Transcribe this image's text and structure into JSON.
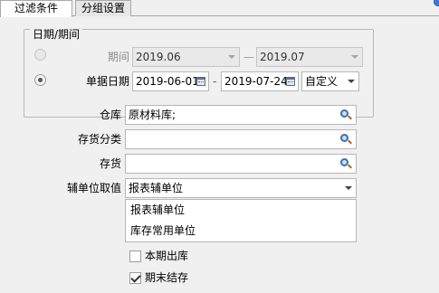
{
  "tabs": [
    {
      "label": "过滤条件",
      "active": true
    },
    {
      "label": "分组设置",
      "active": false
    }
  ],
  "date_group": {
    "legend": "日期/期间",
    "period": {
      "label": "期间",
      "selected": false,
      "start": "2019.06",
      "separator": "—",
      "end": "2019.07"
    },
    "doc_date": {
      "label": "单据日期",
      "selected": true,
      "start": "2019-06-01",
      "separator": "-",
      "end": "2019-07-24",
      "range_type": "自定义"
    }
  },
  "filters": {
    "warehouse": {
      "label": "仓库",
      "value": "原材料库;"
    },
    "inventory_category": {
      "label": "存货分类",
      "value": ""
    },
    "inventory": {
      "label": "存货",
      "value": ""
    },
    "aux_unit": {
      "label": "辅单位取值",
      "value": "报表辅单位"
    }
  },
  "aux_unit_options": [
    "报表辅单位",
    "库存常用单位"
  ],
  "checkboxes": [
    {
      "label": "本期出库",
      "checked": false
    },
    {
      "label": "期末结存",
      "checked": true
    }
  ],
  "colors": {
    "background": "#f0f0f0",
    "field_border": "#b7b7b7",
    "disabled_field": "#e9e9e9"
  }
}
